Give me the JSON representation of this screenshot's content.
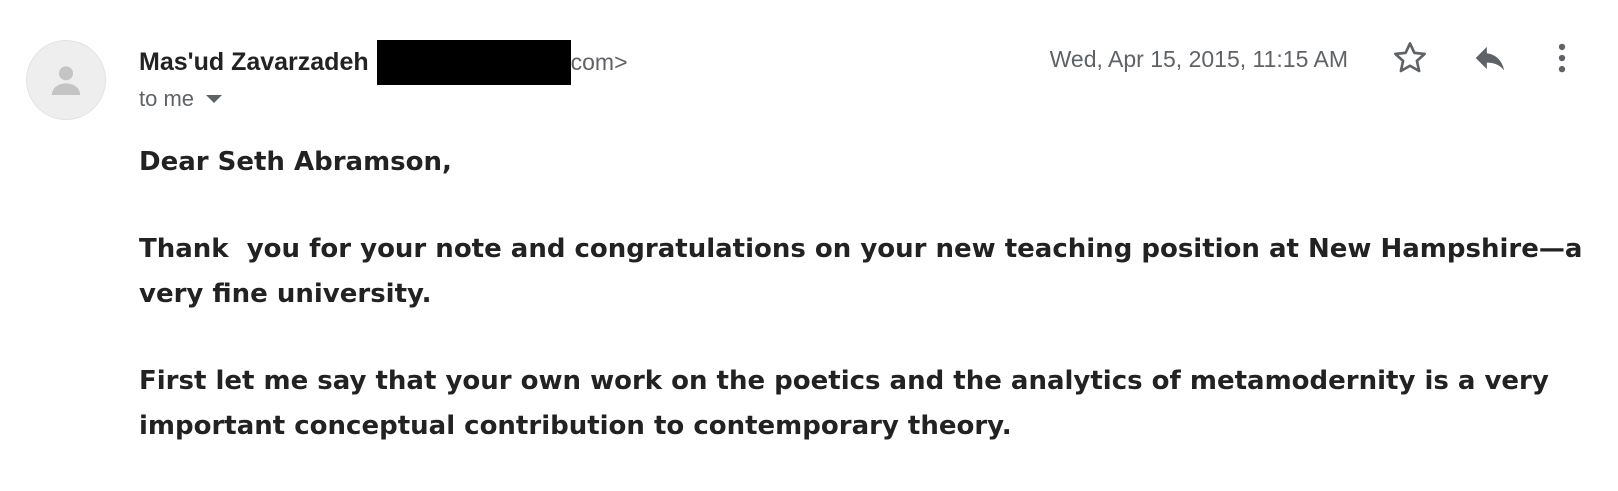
{
  "email": {
    "sender_name": "Mas'ud Zavarzadeh",
    "sender_email_visible": "com>",
    "recipient_label": "to me",
    "timestamp": "Wed, Apr 15, 2015, 11:15 AM",
    "greeting": "Dear Seth Abramson,",
    "paragraphs": [
      "Thank  you for your note and congratulations on your new teaching position at New Hampshire—a very fine university.",
      "First let me say that your own work on the poetics and the analytics of metamodernity is a very important conceptual contribution to contemporary theory."
    ]
  },
  "icons": {
    "avatar": "person-icon",
    "star": "star-icon",
    "reply": "reply-icon",
    "more": "more-vert-icon",
    "caret": "caret-down-icon"
  },
  "colors": {
    "text": "#222222",
    "secondary_text": "#5f6368",
    "avatar_bg": "#eeeeee",
    "redaction": "#000000"
  }
}
